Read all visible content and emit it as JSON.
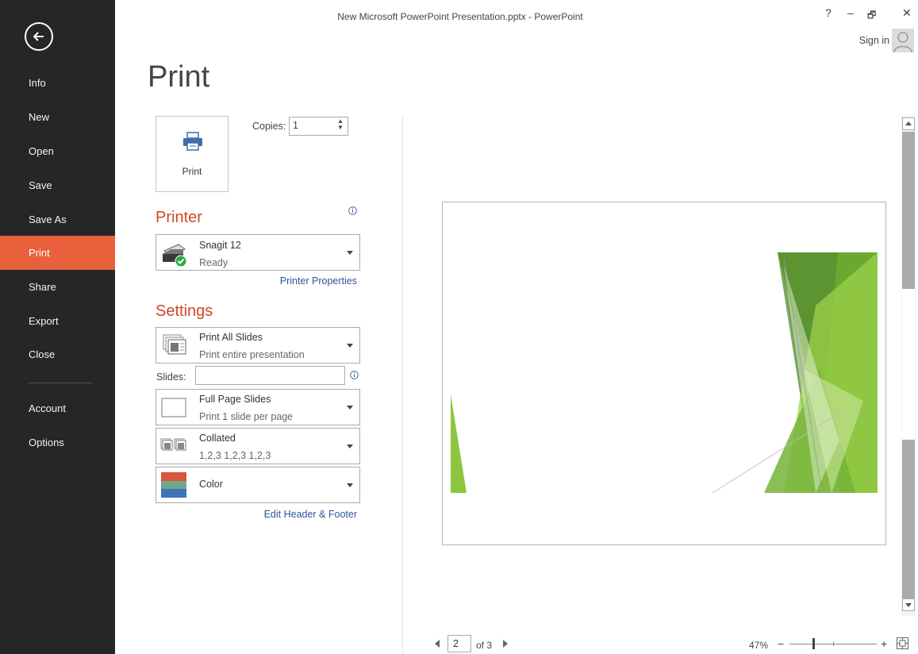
{
  "window": {
    "title": "New Microsoft PowerPoint Presentation.pptx - PowerPoint",
    "help": "?",
    "minimize": "–",
    "restore": "🗗",
    "close": "✕",
    "sign_in": "Sign in"
  },
  "nav": {
    "items": [
      {
        "label": "Info"
      },
      {
        "label": "New"
      },
      {
        "label": "Open"
      },
      {
        "label": "Save"
      },
      {
        "label": "Save As"
      },
      {
        "label": "Print",
        "active": true
      },
      {
        "label": "Share"
      },
      {
        "label": "Export"
      },
      {
        "label": "Close"
      },
      {
        "label": "Account"
      },
      {
        "label": "Options"
      }
    ]
  },
  "page": {
    "title": "Print",
    "print_button": "Print",
    "copies_label": "Copies:",
    "copies_value": "1"
  },
  "printer": {
    "heading": "Printer",
    "name": "Snagit 12",
    "status": "Ready",
    "properties_link": "Printer Properties"
  },
  "settings": {
    "heading": "Settings",
    "range": {
      "title": "Print All Slides",
      "subtitle": "Print entire presentation"
    },
    "slides_label": "Slides:",
    "slides_value": "",
    "layout": {
      "title": "Full Page Slides",
      "subtitle": "Print 1 slide per page"
    },
    "collation": {
      "title": "Collated",
      "subtitle": "1,2,3   1,2,3   1,2,3"
    },
    "color": {
      "title": "Color"
    },
    "header_footer_link": "Edit Header & Footer"
  },
  "preview": {
    "current_page": "2",
    "of_pages": "of 3",
    "zoom": "47%"
  },
  "colors": {
    "nav_bg": "#262626",
    "accent": "#e8603c",
    "heading": "#d24726",
    "link": "#2b5797"
  }
}
